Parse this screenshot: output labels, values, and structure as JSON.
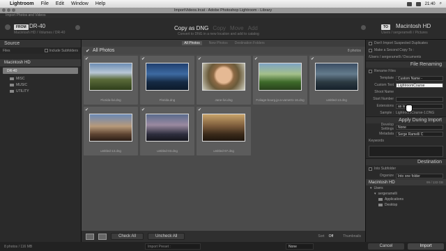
{
  "menubar": {
    "app": "Lightroom",
    "items": [
      "File",
      "Edit",
      "Window",
      "Help"
    ],
    "clock": "21:40"
  },
  "window": {
    "title": "ImportVideos.lrcat - Adobe Photoshop Lightroom - Library",
    "subtitle": "Import Photos and Videos"
  },
  "header": {
    "from_label": "FROM",
    "source_name": "DR-40",
    "source_path": "Macintosh HD / Volumes / DR-40",
    "modes": [
      "Copy as DNG",
      "Copy",
      "Move",
      "Add"
    ],
    "mode_desc": "Convert to DNG in a new location and add to catalog",
    "to_label": "TO",
    "dest_name": "Macintosh HD",
    "dest_path": "Users / sergeramelli / Pictures"
  },
  "left": {
    "title": "Source",
    "files_label": "Files",
    "include_subfolders": "Include Subfolders",
    "drive": "Macintosh HD",
    "volume": "DR-40",
    "folders": [
      "MISC",
      "MUSIC",
      "UTILITY"
    ]
  },
  "center": {
    "filters": [
      "All Photos",
      "New Photos",
      "Destination Folders"
    ],
    "grid_title": "All Photos",
    "grid_count": "8 photos",
    "photos": [
      {
        "name": "Florida-livi.dng"
      },
      {
        "name": "Florida.dng"
      },
      {
        "name": "Jane-livi.dng"
      },
      {
        "name": "Foliage-bourg.jp-a-vame01-16.dng"
      },
      {
        "name": "untitled-13.dng"
      },
      {
        "name": "untitled-13.dng"
      },
      {
        "name": "untitled-03.dng"
      },
      {
        "name": "untitled-97.dng"
      }
    ],
    "check_all": "Check All",
    "uncheck_all": "Uncheck All",
    "sort_label": "Sort",
    "sort_value": "Off",
    "thumbnails_label": "Thumbnails"
  },
  "right": {
    "dont_import_dupes": "Don't Import Suspected Duplicates",
    "second_copy": "Make a Second Copy To :",
    "second_copy_path": "/Users / sergeramelli / Documents",
    "file_renaming": "File Renaming",
    "rename_files": "Rename Files",
    "template_label": "Template",
    "template_value": "Custom Name -",
    "custom_text_label": "Custom Text",
    "custom_text_value": "LightroomCourse",
    "shoot_name_label": "Shoot Name",
    "start_number_label": "Start Number",
    "extensions_label": "Extensions",
    "extensions_value": "as is",
    "sample_label": "Sample :",
    "sample_value": "LightroomCourse-1.DNG",
    "apply_during_import": "Apply During Import",
    "develop_label": "Develop Settings",
    "develop_value": "None",
    "metadata_label": "Metadata",
    "metadata_value": "Serge Ramelli C",
    "keywords_label": "Keywords",
    "destination": "Destination",
    "into_subfolder": "Into Subfolder",
    "organize_label": "Organize",
    "organize_value": "Into one folder",
    "dest_drive": "Macintosh HD",
    "dest_space": "99 / 133 GB",
    "tree": [
      "Users",
      "sergeramelli",
      "Applications",
      "Desktop"
    ]
  },
  "bottom": {
    "status": "8 photos / 116 MB",
    "preset_label": "Import Preset :",
    "preset_value": "None",
    "cancel": "Cancel",
    "import": "Import"
  }
}
